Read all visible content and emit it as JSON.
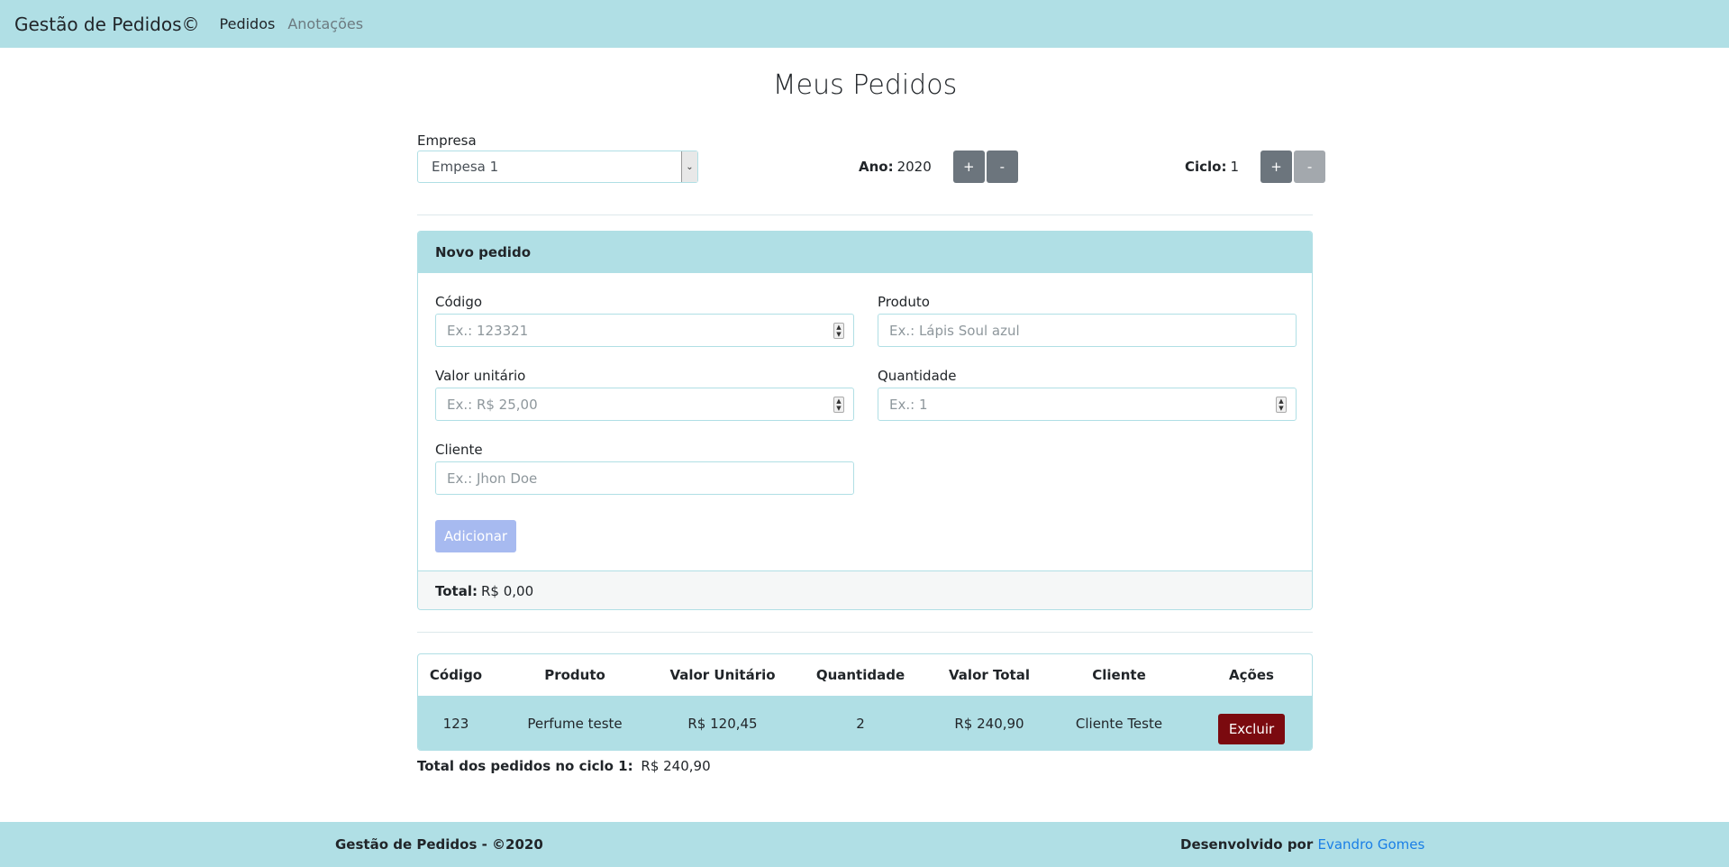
{
  "navbar": {
    "brand": "Gestão de Pedidos©",
    "links": [
      {
        "label": "Pedidos",
        "active": true
      },
      {
        "label": "Anotações",
        "active": false
      }
    ]
  },
  "page": {
    "title": "Meus Pedidos"
  },
  "filters": {
    "empresa_label": "Empresa",
    "empresa_selected": "Empesa 1",
    "ano_label": "Ano:",
    "ano_value": "2020",
    "ciclo_label": "Ciclo:",
    "ciclo_value": "1",
    "plus": "+",
    "minus": "-"
  },
  "form": {
    "header": "Novo pedido",
    "codigo": {
      "label": "Código",
      "placeholder": "Ex.: 123321"
    },
    "produto": {
      "label": "Produto",
      "placeholder": "Ex.: Lápis Soul azul"
    },
    "valor": {
      "label": "Valor unitário",
      "placeholder": "Ex.: R$ 25,00"
    },
    "quantidade": {
      "label": "Quantidade",
      "placeholder": "Ex.: 1"
    },
    "cliente": {
      "label": "Cliente",
      "placeholder": "Ex.: Jhon Doe"
    },
    "add_button": "Adicionar",
    "total_label": "Total:",
    "total_value": "R$ 0,00"
  },
  "table": {
    "headers": [
      "Código",
      "Produto",
      "Valor Unitário",
      "Quantidade",
      "Valor Total",
      "Cliente",
      "Ações"
    ],
    "rows": [
      {
        "codigo": "123",
        "produto": "Perfume teste",
        "valor_unitario": "R$ 120,45",
        "quantidade": "2",
        "valor_total": "R$ 240,90",
        "cliente": "Cliente Teste",
        "acao": "Excluir"
      }
    ],
    "total_label": "Total dos pedidos no ciclo 1:",
    "total_value": "R$ 240,90"
  },
  "footer": {
    "left": "Gestão de Pedidos - ©2020",
    "right_prefix": "Desenvolvido por",
    "author": "Evandro Gomes"
  },
  "colors": {
    "accent": "#b0dfe5",
    "danger": "#7b0a0f",
    "primary_disabled": "#a7baf0",
    "link": "#1a7fe6"
  }
}
